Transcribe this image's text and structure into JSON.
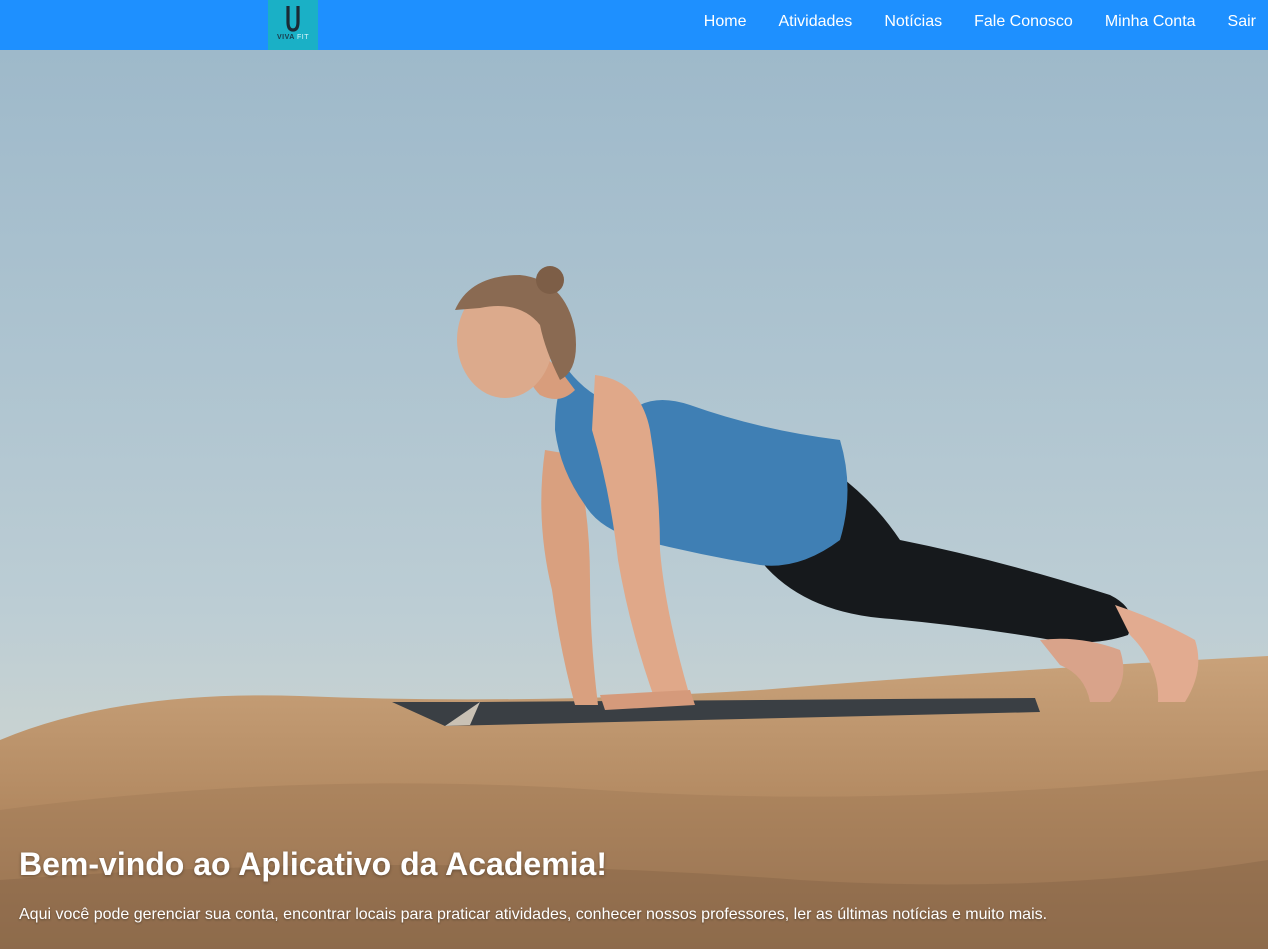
{
  "brand": {
    "logo_letter": "U",
    "logo_name_bold": "VIVA",
    "logo_name_light": "FIT"
  },
  "nav": {
    "items": [
      {
        "label": "Home"
      },
      {
        "label": "Atividades"
      },
      {
        "label": "Notícias"
      },
      {
        "label": "Fale Conosco"
      },
      {
        "label": "Minha Conta"
      },
      {
        "label": "Sair"
      }
    ]
  },
  "hero": {
    "title": "Bem-vindo ao Aplicativo da Academia!",
    "subtitle": "Aqui você pode gerenciar sua conta, encontrar locais para praticar atividades, conhecer nossos professores, ler as últimas notícias e muito mais."
  },
  "colors": {
    "navbar": "#1e90ff",
    "logo_bg": "#1ab0c6",
    "text": "#ffffff"
  }
}
